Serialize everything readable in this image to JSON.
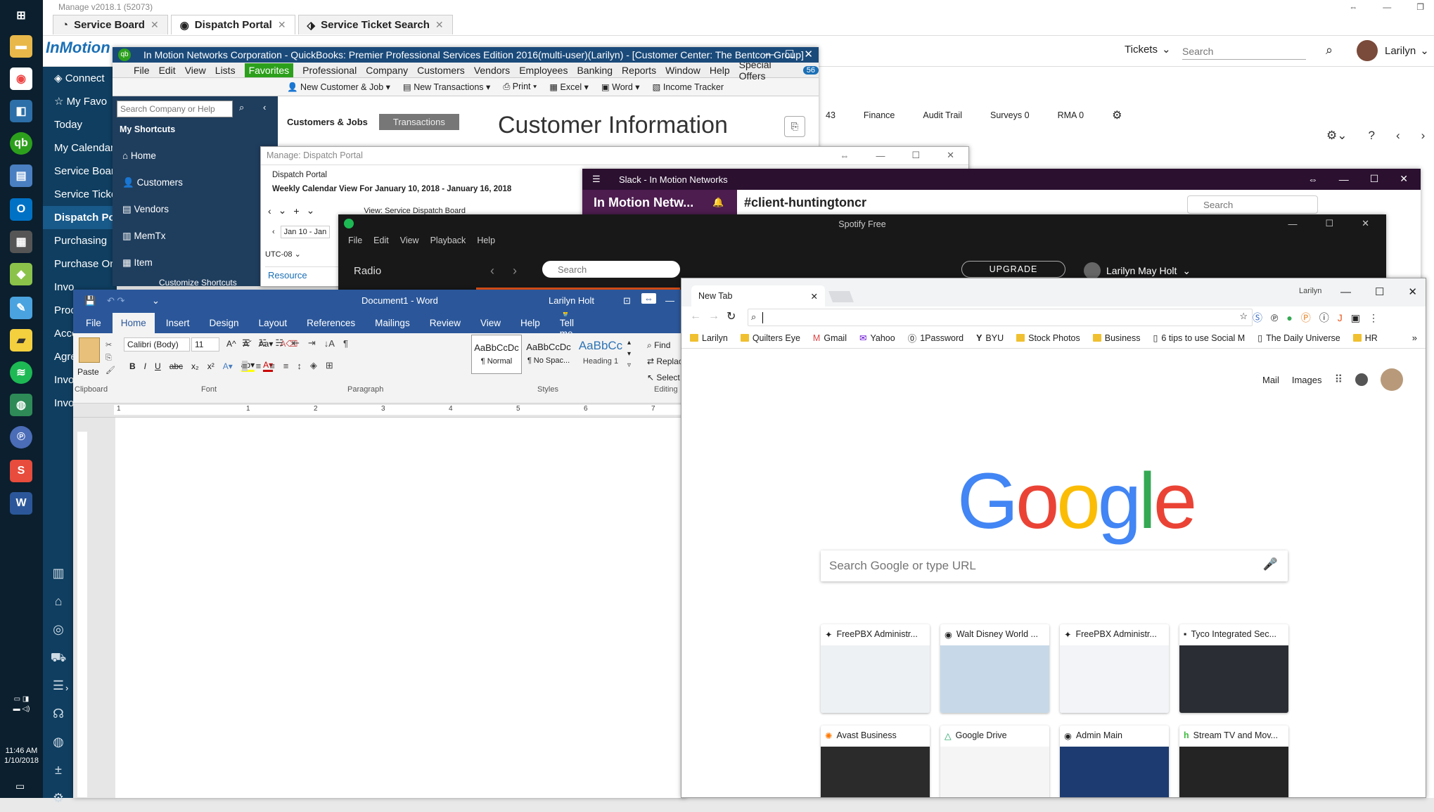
{
  "taskbar": {
    "time": "11:46 AM",
    "date": "1/10/2018"
  },
  "manage": {
    "title": "Manage v2018.1 (52073)",
    "tabs": [
      {
        "label": "Service Board"
      },
      {
        "label": "Dispatch Portal"
      },
      {
        "label": "Service Ticket Search"
      }
    ],
    "logo": "InMotion",
    "tickets_label": "Tickets",
    "search_placeholder": "Search",
    "user_name": "Larilyn",
    "subtabs": [
      "43",
      "Finance",
      "Audit Trail",
      "Surveys 0",
      "RMA 0"
    ],
    "sidebar": [
      "Connect",
      "My Favo",
      "Today",
      "My Calendar",
      "Service Board",
      "Service Ticke",
      "Dispatch Port",
      "Purchasing",
      "Purchase Ord",
      "Invo",
      "Proc",
      "Acco",
      "Agre",
      "Invo",
      "Invo"
    ]
  },
  "quickbooks": {
    "title": "In Motion Networks Corporation  - QuickBooks: Premier Professional Services Edition 2016(multi-user)(Larilyn) - [Customer Center: The Bentcon Group]",
    "menu": [
      "File",
      "Edit",
      "View",
      "Lists",
      "Favorites",
      "Professional",
      "Company",
      "Customers",
      "Vendors",
      "Employees",
      "Banking",
      "Reports",
      "Window",
      "Help",
      "Special Offers"
    ],
    "badge": "56",
    "toolbar": [
      "New Customer & Job",
      "New Transactions",
      "Print",
      "Excel",
      "Word",
      "Income Tracker"
    ],
    "search_placeholder": "Search Company or Help",
    "shortcuts_header": "My Shortcuts",
    "shortcuts": [
      "Home",
      "Customers",
      "Vendors",
      "MemTx",
      "Item"
    ],
    "customize": "Customize Shortcuts",
    "center_tabs": [
      "Customers & Jobs",
      "Transactions"
    ],
    "info_title": "Customer Information"
  },
  "dispatch": {
    "title": "Manage: Dispatch Portal",
    "subtitle": "Dispatch Portal",
    "view_label": "Weekly Calendar View For January 10, 2018 - January 16, 2018",
    "view_select": "View: Service Dispatch Board",
    "date_range": "Jan 10 - Jan",
    "timezone": "UTC-08",
    "resource": "Resource"
  },
  "slack": {
    "title": "Slack - In Motion Networks",
    "workspace": "In Motion Netw...",
    "channel": "#client-huntingtoncr",
    "search_placeholder": "Search"
  },
  "spotify": {
    "title": "Spotify Free",
    "menu": [
      "File",
      "Edit",
      "View",
      "Playback",
      "Help"
    ],
    "radio": "Radio",
    "search_placeholder": "Search",
    "upgrade": "UPGRADE",
    "user": "Larilyn May Holt"
  },
  "word": {
    "title": "Document1 - Word",
    "user": "Larilyn Holt",
    "tabs": [
      "File",
      "Home",
      "Insert",
      "Design",
      "Layout",
      "References",
      "Mailings",
      "Review",
      "View",
      "Help",
      "Tell me"
    ],
    "share": "Sh",
    "paste": "Paste",
    "font_name": "Calibri (Body)",
    "font_size": "11",
    "styles": [
      {
        "preview": "AaBbCcDc",
        "name": "¶ Normal"
      },
      {
        "preview": "AaBbCcDc",
        "name": "¶ No Spac..."
      },
      {
        "preview": "AaBbCc",
        "name": "Heading 1"
      }
    ],
    "editing": [
      "Find",
      "Replac",
      "Select"
    ],
    "groups": [
      "Clipboard",
      "Font",
      "Paragraph",
      "Styles",
      "Editing"
    ],
    "ruler": [
      "1",
      "1",
      "2",
      "3",
      "4",
      "5",
      "6",
      "7"
    ]
  },
  "chrome": {
    "tab_label": "New Tab",
    "profile": "Larilyn",
    "bookmarks": [
      "Larilyn",
      "Quilters Eye",
      "Gmail",
      "Yahoo",
      "1Password",
      "BYU",
      "Stock Photos",
      "Business",
      "6 tips to use Social M",
      "The Daily Universe",
      "HR"
    ],
    "header_links": [
      "Mail",
      "Images"
    ],
    "logo": [
      "G",
      "o",
      "o",
      "g",
      "l",
      "e"
    ],
    "logo_colors": [
      "#4285f4",
      "#ea4335",
      "#fbbc05",
      "#4285f4",
      "#34a853",
      "#ea4335"
    ],
    "search_placeholder": "Search Google or type URL",
    "tiles": [
      {
        "title": "FreePBX Administr...",
        "thumb": "#eef1f4"
      },
      {
        "title": "Walt Disney World ...",
        "thumb": "#c7d9e8"
      },
      {
        "title": "FreePBX Administr...",
        "thumb": "#f2f4f7"
      },
      {
        "title": "Tyco Integrated Sec...",
        "thumb": "#2a2d33"
      },
      {
        "title": "Avast Business",
        "thumb": "#2b2b2b"
      },
      {
        "title": "Google Drive",
        "thumb": "#f5f5f5"
      },
      {
        "title": "Admin Main",
        "thumb": "#1d3b70"
      },
      {
        "title": "Stream TV and Mov...",
        "thumb": "#242424"
      }
    ]
  }
}
